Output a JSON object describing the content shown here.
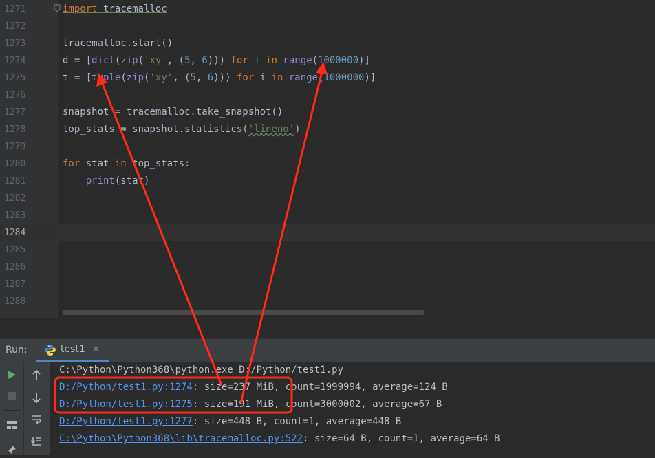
{
  "editor": {
    "line_numbers": [
      "1271",
      "1272",
      "1273",
      "1274",
      "1275",
      "1276",
      "1277",
      "1278",
      "1279",
      "1280",
      "1281",
      "1282",
      "1283",
      "1284",
      "1285",
      "1286",
      "1287",
      "1288"
    ],
    "lines": {
      "l1271": {
        "kw": "import",
        "rest": " tracemalloc"
      },
      "l1273": {
        "text": "tracemalloc.start()"
      },
      "l1274": {
        "a": "d = [",
        "b1": "dict",
        "p1": "(",
        "b2": "zip",
        "p2": "(",
        "s1": "'xy'",
        "p3": ", (",
        "n1": "5",
        "p4": ", ",
        "n2": "6",
        "p5": "))) ",
        "k1": "for",
        "p6": " i ",
        "k2": "in",
        "p7": " ",
        "b3": "range",
        "p8": "(",
        "n3": "1000000",
        "p9": ")]"
      },
      "l1275": {
        "a": "t = [",
        "b1": "tuple",
        "p1": "(",
        "b2": "zip",
        "p2": "(",
        "s1": "'xy'",
        "p3": ", (",
        "n1": "5",
        "p4": ", ",
        "n2": "6",
        "p5": "))) ",
        "k1": "for",
        "p6": " i ",
        "k2": "in",
        "p7": " ",
        "b3": "range",
        "p8": "(",
        "n3": "1000000",
        "p9": ")]"
      },
      "l1277": {
        "text": "snapshot = tracemalloc.take_snapshot()"
      },
      "l1278": {
        "a": "top_stats = snapshot.statistics(",
        "s1": "'lineno'",
        "b": ")"
      },
      "l1280": {
        "k1": "for",
        "a": " stat ",
        "k2": "in",
        "b": " top_stats:"
      },
      "l1281": {
        "indent": "    ",
        "b1": "print",
        "a": "(stat)"
      }
    }
  },
  "run_panel": {
    "label": "Run:",
    "tab_label": "test1",
    "close_glyph": "×",
    "output": [
      {
        "text": "C:\\Python\\Python368\\python.exe D:/Python/test1.py"
      },
      {
        "link": "D:/Python/test1.py:1274",
        "rest": ": size=237 MiB, count=1999994, average=124 B"
      },
      {
        "link": "D:/Python/test1.py:1275",
        "rest": ": size=191 MiB, count=3000002, average=67 B"
      },
      {
        "link": "D:/Python/test1.py:1277",
        "rest": ": size=448 B, count=1, average=448 B"
      },
      {
        "link": "C:\\Python\\Python368\\lib\\tracemalloc.py:522",
        "rest": ": size=64 B, count=1, average=64 B"
      }
    ],
    "tools": [
      "run-icon",
      "stop-icon",
      "layout-icon",
      "pin-icon",
      "arrow-up-icon",
      "arrow-down-icon",
      "soft-wrap-icon",
      "scroll-to-end-icon"
    ]
  },
  "colors": {
    "annotation": "#ff2a1a",
    "link": "#5394ec",
    "keyword": "#cc7832",
    "builtin": "#8888c6",
    "string": "#6a8759",
    "number": "#6897bb"
  }
}
